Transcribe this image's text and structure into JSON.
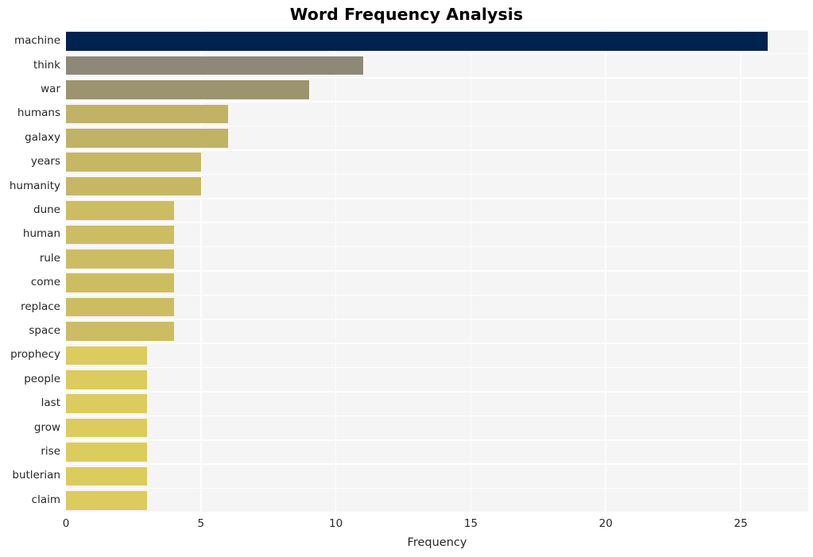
{
  "chart_data": {
    "type": "bar",
    "orientation": "horizontal",
    "title": "Word Frequency Analysis",
    "xlabel": "Frequency",
    "ylabel": "",
    "categories": [
      "machine",
      "think",
      "war",
      "humans",
      "galaxy",
      "years",
      "humanity",
      "dune",
      "human",
      "rule",
      "come",
      "replace",
      "space",
      "prophecy",
      "people",
      "last",
      "grow",
      "rise",
      "butlerian",
      "claim"
    ],
    "values": [
      26,
      11,
      9,
      6,
      6,
      5,
      5,
      4,
      4,
      4,
      4,
      4,
      4,
      3,
      3,
      3,
      3,
      3,
      3,
      3
    ],
    "bar_colors": [
      "#00224e",
      "#8e8878",
      "#9c946e",
      "#c0b267",
      "#c0b267",
      "#c6b765",
      "#c6b765",
      "#cdbd62",
      "#cdbd62",
      "#cdbd62",
      "#cdbd62",
      "#cdbd62",
      "#cdbd62",
      "#dccb5d",
      "#dccb5d",
      "#dccb5d",
      "#dccb5d",
      "#dccb5d",
      "#dccb5d",
      "#dccb5d"
    ],
    "xlim": [
      0,
      27.5
    ],
    "xticks": [
      0,
      5,
      10,
      15,
      20,
      25
    ],
    "xtick_labels": [
      "0",
      "5",
      "10",
      "15",
      "20",
      "25"
    ],
    "grid": true,
    "grid_color": "#ffffff",
    "plot_background": "#f5f5f5",
    "figure_background": "#ffffff",
    "legend": null
  }
}
